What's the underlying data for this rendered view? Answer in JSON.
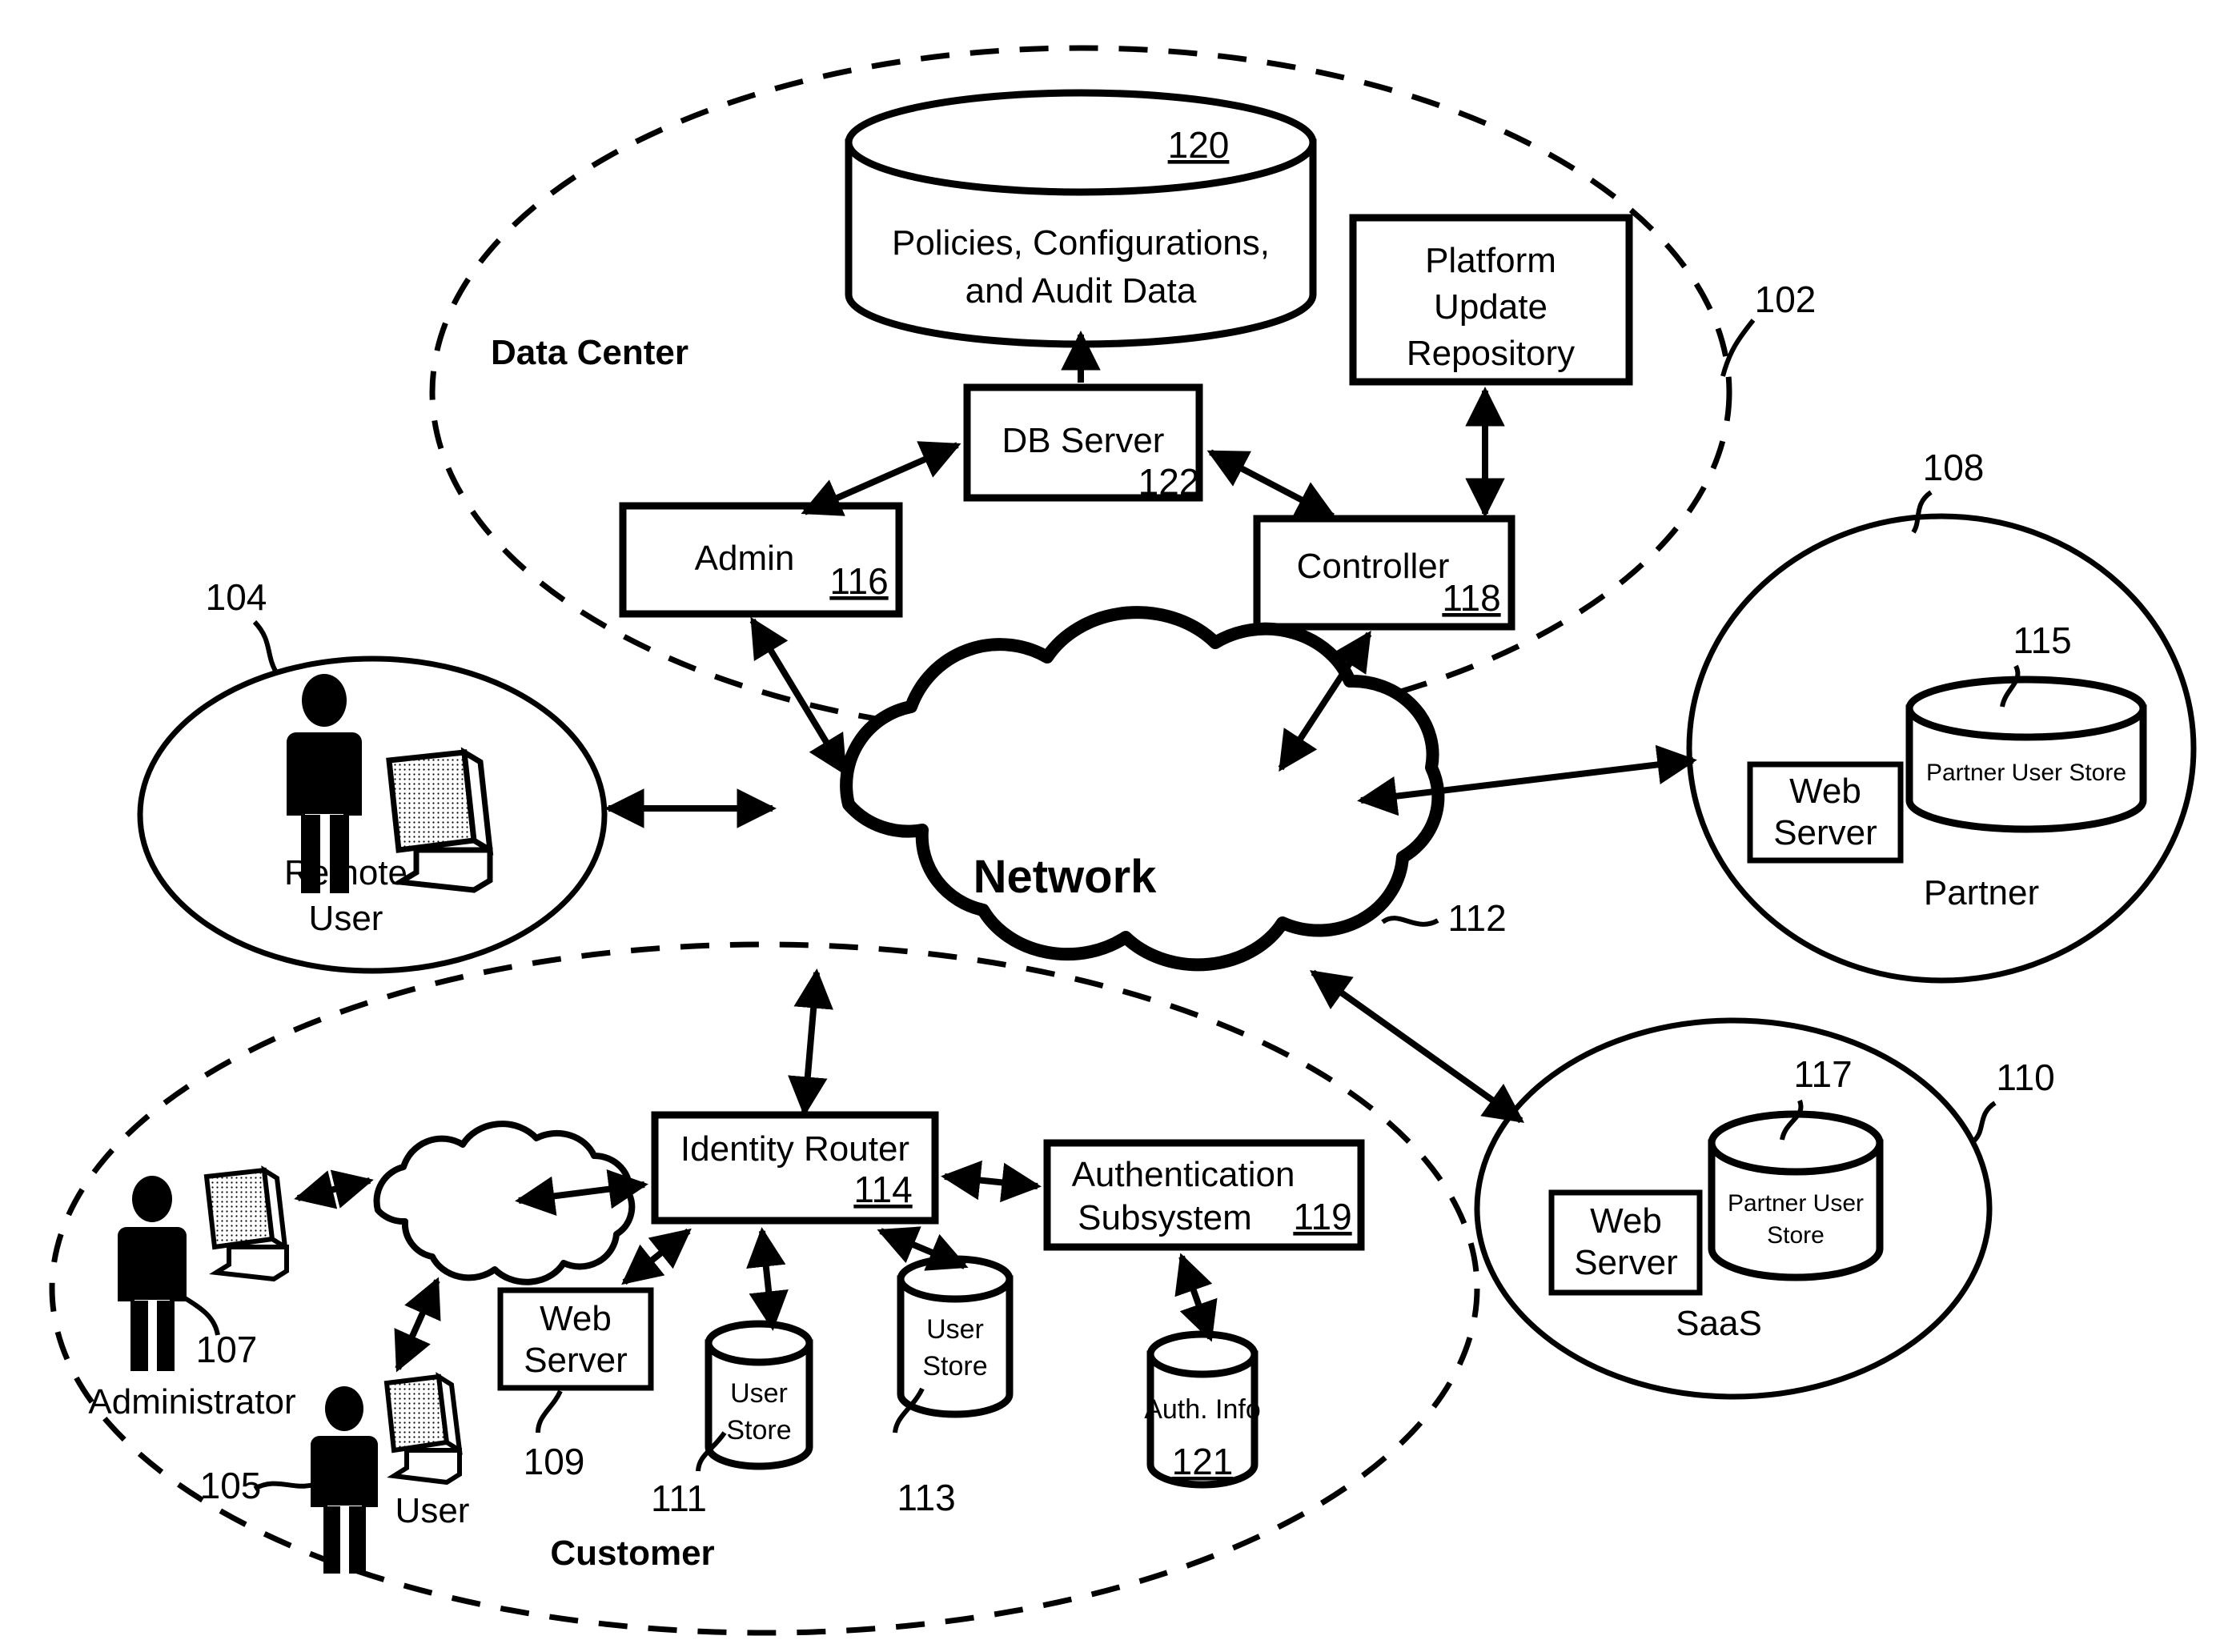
{
  "figure": {
    "type": "network-architecture-diagram",
    "regions": [
      {
        "id": "data-center",
        "label": "Data Center",
        "ref": "102",
        "boundary": "dashed-ellipse"
      },
      {
        "id": "remote-user",
        "label_line1": "Remote",
        "label_line2": "User",
        "ref": "104",
        "boundary": "solid-ellipse"
      },
      {
        "id": "partner",
        "label": "Partner",
        "ref": "108",
        "boundary": "solid-ellipse"
      },
      {
        "id": "saas",
        "label": "SaaS",
        "ref": "110",
        "boundary": "solid-ellipse"
      },
      {
        "id": "customer",
        "label": "Customer",
        "ref": "105",
        "boundary": "dashed-ellipse"
      }
    ],
    "nodes": {
      "policies_db": {
        "ref": "120",
        "line1": "Policies, Configurations,",
        "line2": "and Audit Data",
        "shape": "cylinder"
      },
      "platform_update_repo": {
        "line1": "Platform",
        "line2": "Update",
        "line3": "Repository",
        "shape": "rect"
      },
      "db_server": {
        "label": "DB Server",
        "ref": "122",
        "shape": "rect"
      },
      "admin": {
        "label": "Admin",
        "ref": "116",
        "shape": "rect"
      },
      "controller": {
        "label": "Controller",
        "ref": "118",
        "shape": "rect"
      },
      "network_cloud": {
        "label": "Network",
        "ref": "112",
        "shape": "cloud"
      },
      "partner_web_server": {
        "line1": "Web",
        "line2": "Server",
        "shape": "rect"
      },
      "partner_user_store": {
        "label": "Partner User Store",
        "ref": "115",
        "shape": "cylinder"
      },
      "saas_web_server": {
        "line1": "Web",
        "line2": "Server",
        "shape": "rect"
      },
      "saas_user_store": {
        "line1": "Partner User",
        "line2": "Store",
        "ref": "117",
        "shape": "cylinder"
      },
      "identity_router": {
        "label": "Identity Router",
        "ref": "114",
        "shape": "rect"
      },
      "auth_subsystem": {
        "line1": "Authentication",
        "line2": "Subsystem",
        "ref": "119",
        "shape": "rect"
      },
      "customer_web_server": {
        "line1": "Web",
        "line2": "Server",
        "ref": "109",
        "shape": "rect"
      },
      "user_store_1": {
        "line1": "User",
        "line2": "Store",
        "ref": "111",
        "shape": "cylinder"
      },
      "user_store_2": {
        "line1": "User",
        "line2": "Store",
        "ref": "113",
        "shape": "cylinder"
      },
      "auth_info": {
        "label": "Auth. Info",
        "ref": "121",
        "shape": "cylinder"
      },
      "administrator": {
        "label": "Administrator",
        "ref": "107",
        "shape": "person-with-monitor"
      },
      "customer_user": {
        "label": "User",
        "ref": "105",
        "shape": "person-with-monitor"
      },
      "remote_user_figure": {
        "shape": "person-with-monitor"
      },
      "internal_cloud": {
        "shape": "cloud"
      }
    },
    "colors": {
      "ink": "#000000",
      "paper": "#ffffff"
    }
  }
}
